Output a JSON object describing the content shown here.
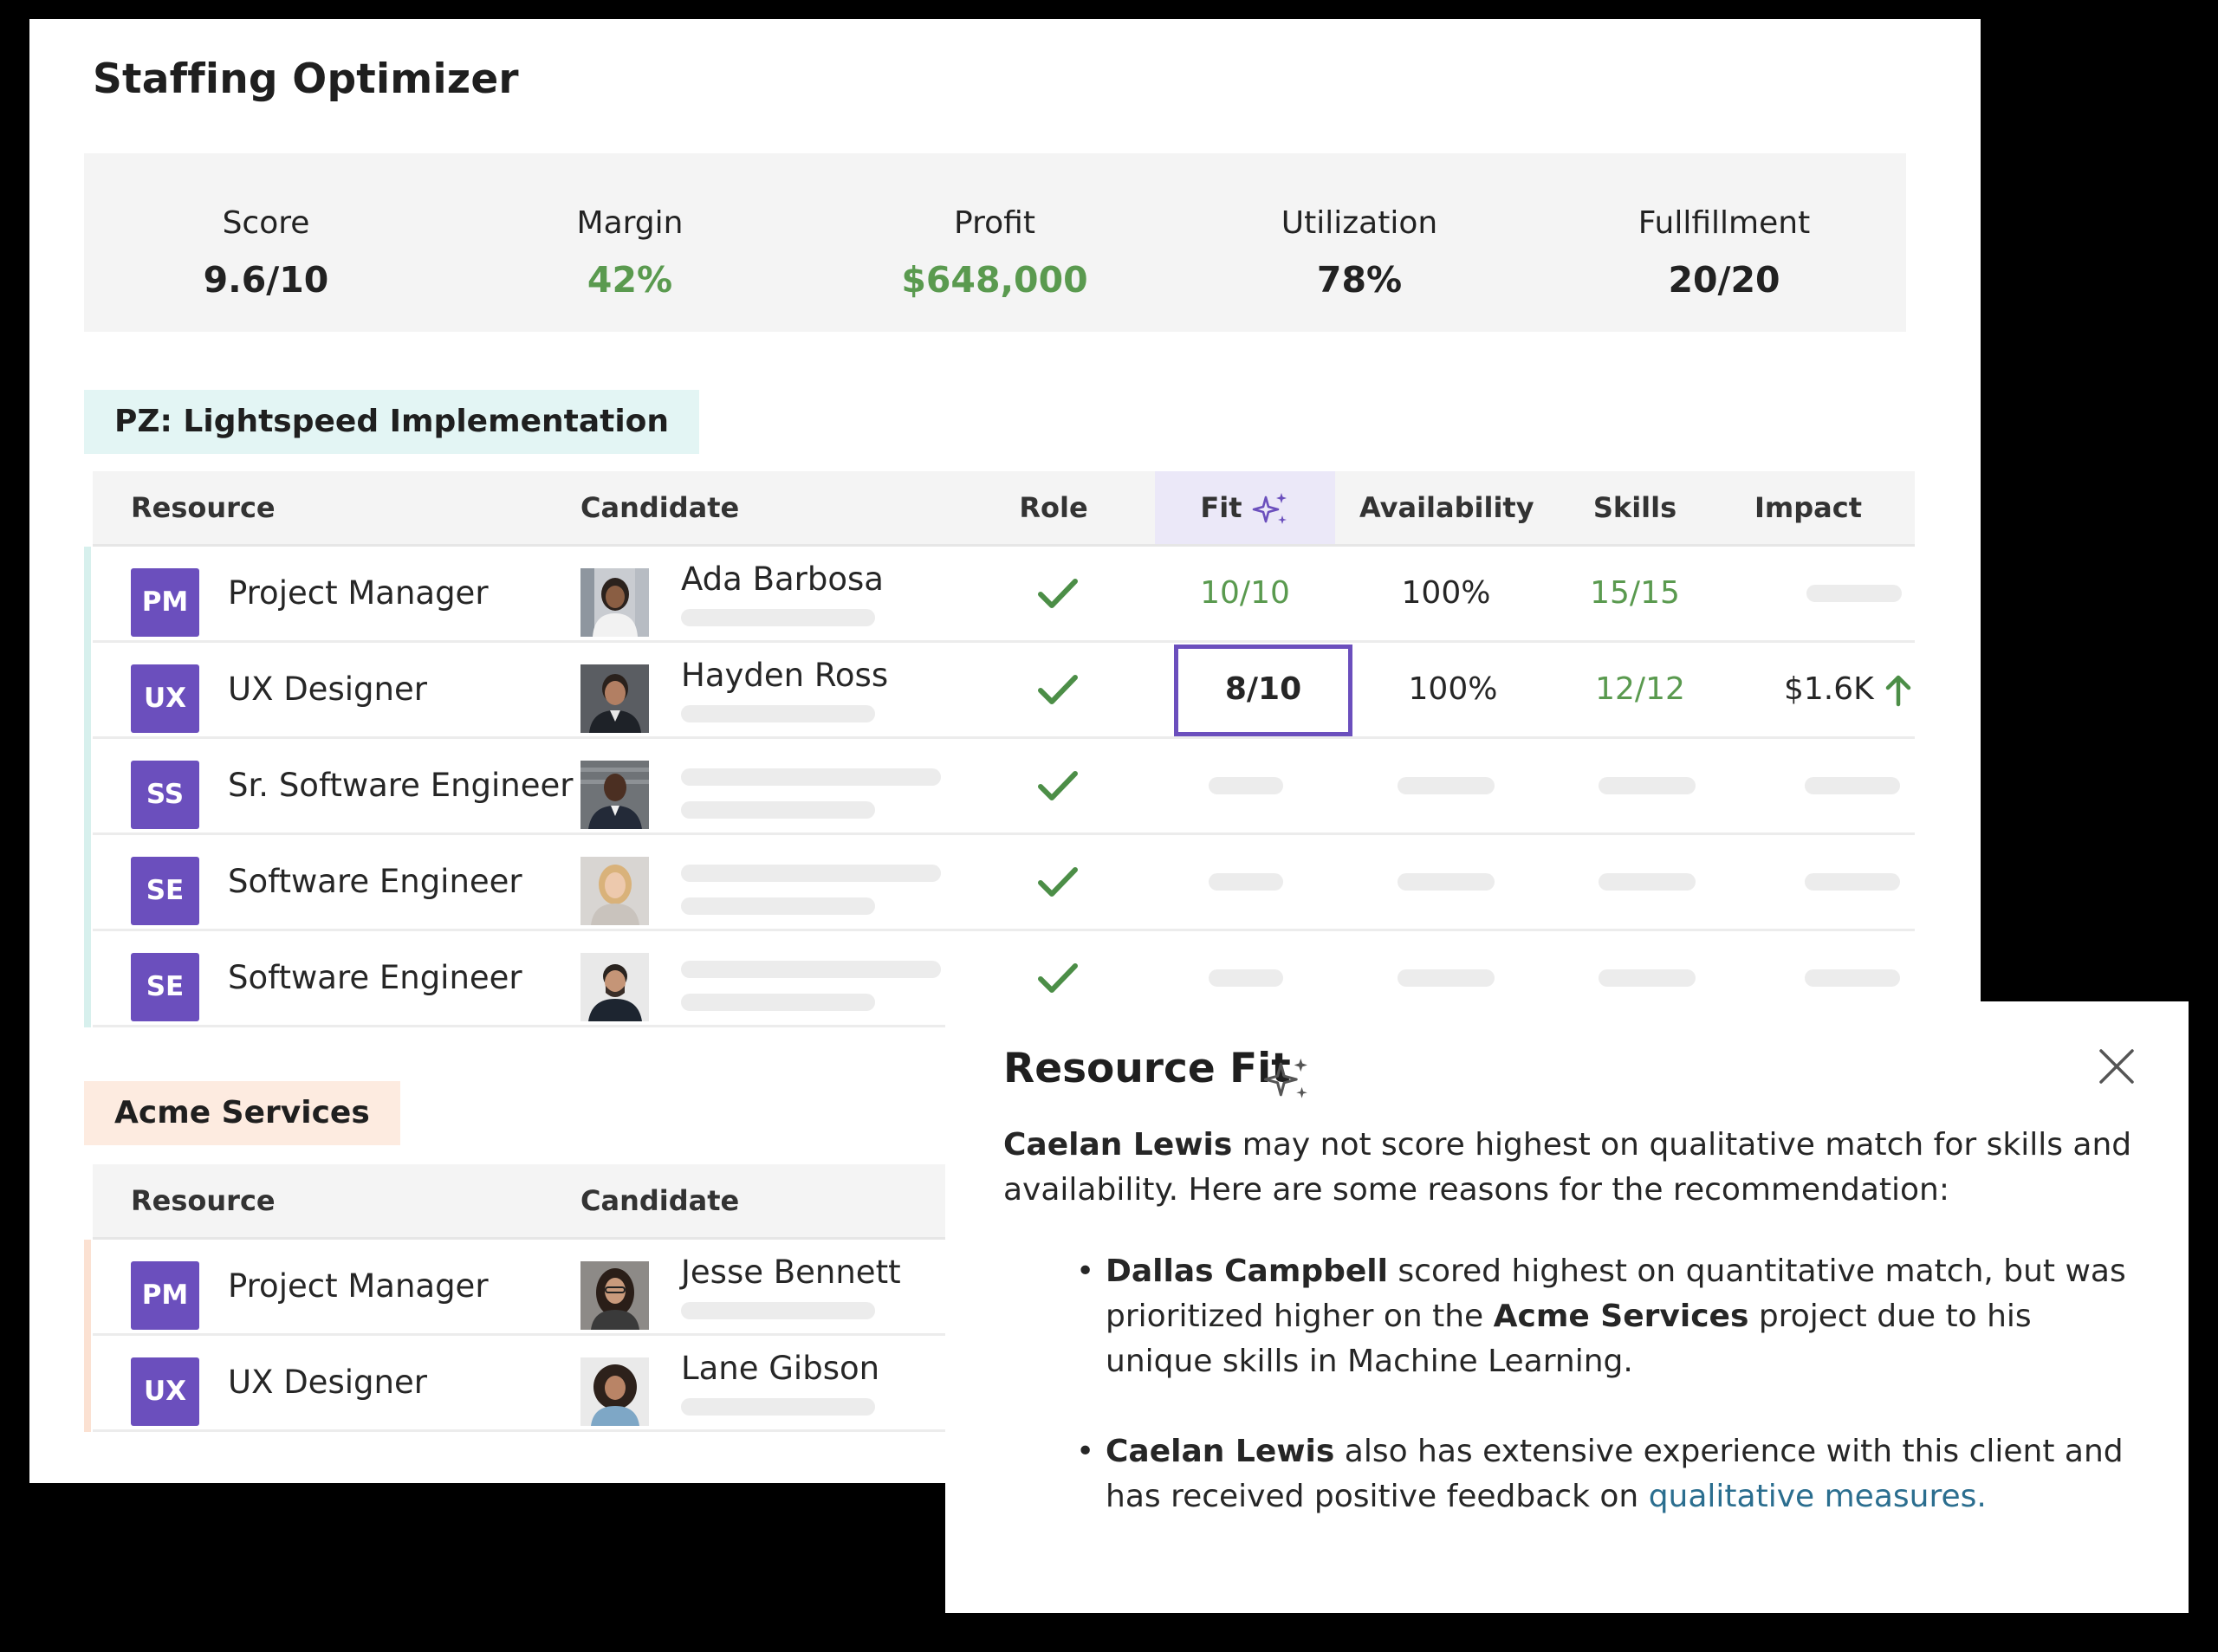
{
  "app": {
    "title": "Staffing Optimizer"
  },
  "metrics": [
    {
      "label": "Score",
      "value": "9.6/10",
      "color": "#222222"
    },
    {
      "label": "Margin",
      "value": "42%",
      "color": "#5a9a4f"
    },
    {
      "label": "Profit",
      "value": "$648,000",
      "color": "#5a9a4f"
    },
    {
      "label": "Utilization",
      "value": "78%",
      "color": "#222222"
    },
    {
      "label": "Fullfillment",
      "value": "20/20",
      "color": "#222222"
    }
  ],
  "projects": [
    {
      "name": "PZ: Lightspeed Implementation",
      "columns": [
        "Resource",
        "Candidate",
        "Role",
        "Fit",
        "Availability",
        "Skills",
        "Impact"
      ],
      "rows": [
        {
          "badge": "PM",
          "resource": "Project Manager",
          "candidate": "Ada Barbosa",
          "role_match": true,
          "fit": "10/10",
          "availability": "100%",
          "skills": "15/15",
          "impact": ""
        },
        {
          "badge": "UX",
          "resource": "UX Designer",
          "candidate": "Hayden Ross",
          "role_match": true,
          "fit": "8/10",
          "availability": "100%",
          "skills": "12/12",
          "impact": "$1.6K"
        },
        {
          "badge": "SS",
          "resource": "Sr. Software Engineer",
          "candidate": "",
          "role_match": true,
          "fit": "",
          "availability": "",
          "skills": "",
          "impact": ""
        },
        {
          "badge": "SE",
          "resource": "Software Engineer",
          "candidate": "",
          "role_match": true,
          "fit": "",
          "availability": "",
          "skills": "",
          "impact": ""
        },
        {
          "badge": "SE",
          "resource": "Software Engineer",
          "candidate": "",
          "role_match": true,
          "fit": "",
          "availability": "",
          "skills": "",
          "impact": ""
        }
      ]
    },
    {
      "name": "Acme Services",
      "columns": [
        "Resource",
        "Candidate"
      ],
      "rows": [
        {
          "badge": "PM",
          "resource": "Project Manager",
          "candidate": "Jesse Bennett"
        },
        {
          "badge": "UX",
          "resource": "UX Designer",
          "candidate": "Lane Gibson"
        }
      ]
    }
  ],
  "popup": {
    "title": "Resource Fit",
    "intro_name": "Caelan Lewis",
    "intro_text": " may not score highest on qualitative match for skills and availability. Here are some reasons for the recommendation:",
    "bullet1_name": "Dallas Campbell",
    "bullet1_text_a": " scored highest on quantitative match, but was prioritized higher on the ",
    "bullet1_project": "Acme Services",
    "bullet1_text_b": " project due to his unique skills in Machine Learning.",
    "bullet2_name": "Caelan Lewis",
    "bullet2_text": " also has extensive experience with this client and has received positive feedback on ",
    "bullet2_link": "qualitative measures."
  },
  "colors": {
    "accent": "#6b4fbd",
    "positive": "#5a9a4f",
    "link": "#2b6e8f",
    "project1_tag": "#e3f5f4",
    "project2_tag": "#fdebe0"
  },
  "icons": {
    "fit_header": "sparkle-icon",
    "role_match": "check-icon",
    "impact_trend": "arrow-up-icon",
    "popup_close": "close-icon"
  }
}
